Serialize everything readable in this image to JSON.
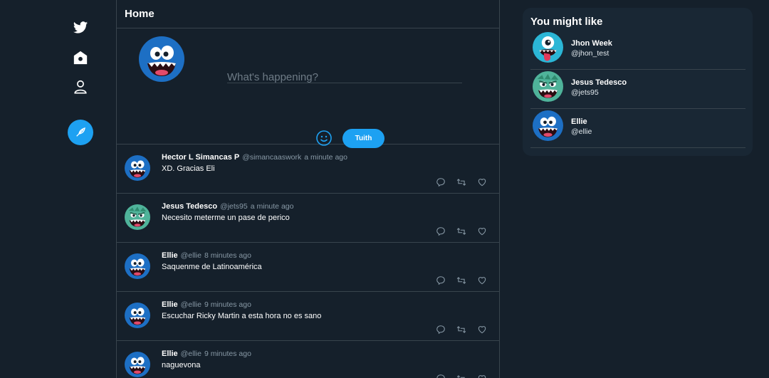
{
  "colors": {
    "background": "#15202b",
    "panel": "#192734",
    "accent": "#1da1f2",
    "border": "#38444d",
    "muted": "#8899a6"
  },
  "nav": {
    "icons": [
      "twitter-bird-icon",
      "home-icon",
      "profile-icon"
    ],
    "compose_icon": "feather-icon"
  },
  "header": {
    "title": "Home"
  },
  "composer": {
    "placeholder": "What's happening?",
    "emoji_icon": "smiley-icon",
    "submit_label": "Tuith"
  },
  "tweets": [
    {
      "name": "Hector L Simancas P",
      "handle": "@simancaaswork",
      "time": "a minute ago",
      "text": "XD. Gracias Eli",
      "avatar": "blue-monster"
    },
    {
      "name": "Jesus Tedesco",
      "handle": "@jets95",
      "time": "a minute ago",
      "text": "Necesito meterme un pase de perico",
      "avatar": "green-monster"
    },
    {
      "name": "Ellie",
      "handle": "@ellie",
      "time": "8 minutes ago",
      "text": "Saquenme de Latinoamérica",
      "avatar": "blue-monster"
    },
    {
      "name": "Ellie",
      "handle": "@ellie",
      "time": "9 minutes ago",
      "text": "Escuchar Ricky Martin a esta hora no es sano",
      "avatar": "blue-monster"
    },
    {
      "name": "Ellie",
      "handle": "@ellie",
      "time": "9 minutes ago",
      "text": "naguevona",
      "avatar": "blue-monster"
    }
  ],
  "tweet_actions": [
    "reply-icon",
    "retweet-icon",
    "like-icon"
  ],
  "suggestions": {
    "title": "You might like",
    "items": [
      {
        "name": "Jhon Week",
        "handle": "@jhon_test",
        "avatar": "cyclops-monster"
      },
      {
        "name": "Jesus Tedesco",
        "handle": "@jets95",
        "avatar": "green-monster"
      },
      {
        "name": "Ellie",
        "handle": "@ellie",
        "avatar": "blue-monster"
      }
    ]
  }
}
